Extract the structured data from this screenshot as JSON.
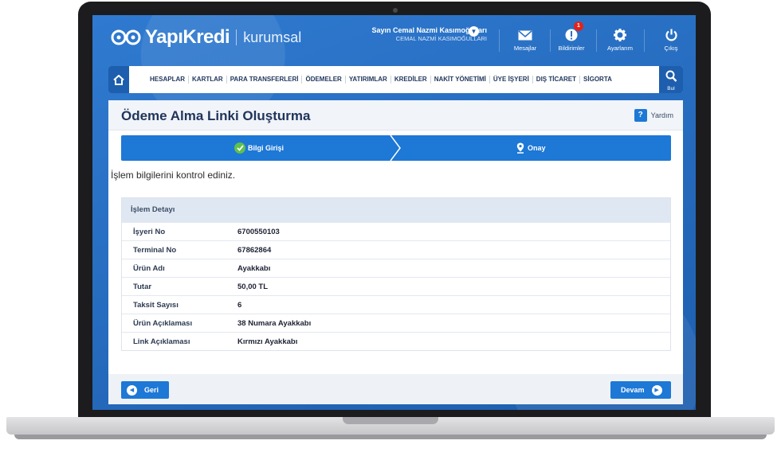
{
  "brand": {
    "name": "YapıKredi",
    "product": "kurumsal"
  },
  "user": {
    "greeting": "Sayın Cemal Nazmi Kasımoğulları",
    "company": "CEMAL NAZMİ KASIMOĞULLARI"
  },
  "header_actions": [
    {
      "label": "Mesajlar",
      "icon": "envelope-icon"
    },
    {
      "label": "Bildirimler",
      "icon": "bell-alert-icon",
      "badge": "1"
    },
    {
      "label": "Ayarlarım",
      "icon": "gear-icon"
    },
    {
      "label": "Çıkış",
      "icon": "power-icon"
    }
  ],
  "nav": {
    "items": [
      "HESAPLAR",
      "KARTLAR",
      "PARA TRANSFERLERİ",
      "ÖDEMELER",
      "YATIRIMLAR",
      "KREDİLER",
      "NAKİT YÖNETİMİ",
      "ÜYE İŞYERİ",
      "DIŞ TİCARET",
      "SİGORTA"
    ],
    "search_label": "Bul"
  },
  "page": {
    "title": "Ödeme Alma Linki Oluşturma",
    "help_label": "Yardım",
    "instruction": "İşlem bilgilerini kontrol ediniz."
  },
  "steps": [
    {
      "label": "Bilgi Girişi",
      "status": "completed"
    },
    {
      "label": "Onay",
      "status": "current"
    }
  ],
  "detail": {
    "header": "İşlem Detayı",
    "rows": [
      {
        "label": "İşyeri No",
        "value": "6700550103"
      },
      {
        "label": "Terminal No",
        "value": "67862864"
      },
      {
        "label": "Ürün Adı",
        "value": "Ayakkabı"
      },
      {
        "label": "Tutar",
        "value": "50,00 TL"
      },
      {
        "label": "Taksit Sayısı",
        "value": "6"
      },
      {
        "label": "Ürün Açıklaması",
        "value": "38 Numara Ayakkabı"
      },
      {
        "label": "Link Açıklaması",
        "value": "Kırmızı Ayakkabı"
      }
    ]
  },
  "buttons": {
    "back": "Geri",
    "continue": "Devam"
  },
  "colors": {
    "header_blue": "#2c6fc0",
    "primary_blue": "#1d78d6",
    "check_green": "#5fc14c",
    "badge_red": "#e2231a"
  }
}
